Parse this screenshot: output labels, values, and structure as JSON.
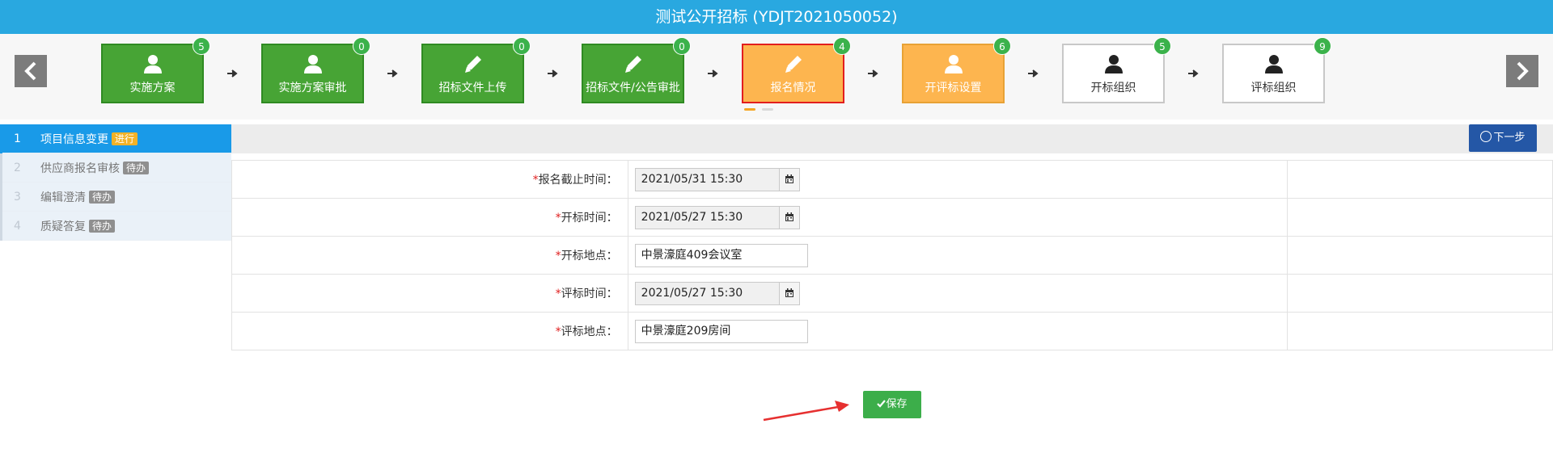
{
  "title": "测试公开招标 (YDJT2021050052)",
  "nav": {
    "prev_icon": "chevron-left-icon",
    "next_icon": "chevron-right-icon"
  },
  "steps": [
    {
      "label": "实施方案",
      "badge": "5",
      "icon": "user-icon",
      "state": "done"
    },
    {
      "label": "实施方案审批",
      "badge": "0",
      "icon": "user-icon",
      "state": "done"
    },
    {
      "label": "招标文件上传",
      "badge": "0",
      "icon": "pencil-icon",
      "state": "done"
    },
    {
      "label": "招标文件/公告审批",
      "badge": "0",
      "icon": "pencil-icon",
      "state": "done"
    },
    {
      "label": "报名情况",
      "badge": "4",
      "icon": "pencil-icon",
      "state": "current"
    },
    {
      "label": "开评标设置",
      "badge": "6",
      "icon": "user-icon",
      "state": "pending-active"
    },
    {
      "label": "开标组织",
      "badge": "5",
      "icon": "user-icon",
      "state": "pending"
    },
    {
      "label": "评标组织",
      "badge": "9",
      "icon": "user-icon",
      "state": "pending"
    }
  ],
  "sidebar": {
    "items": [
      {
        "num": "1",
        "label": "项目信息变更",
        "tag": "进行",
        "active": true
      },
      {
        "num": "2",
        "label": "供应商报名审核",
        "tag": "待办",
        "active": false
      },
      {
        "num": "3",
        "label": "编辑澄清",
        "tag": "待办",
        "active": false
      },
      {
        "num": "4",
        "label": "质疑答复",
        "tag": "待办",
        "active": false
      }
    ]
  },
  "toolbar": {
    "next_label": "下一步"
  },
  "form": {
    "rows": [
      {
        "required": "*",
        "label": "报名截止时间：",
        "value": "2021/05/31 15:30",
        "type": "date"
      },
      {
        "required": "*",
        "label": "开标时间：",
        "value": "2021/05/27 15:30",
        "type": "date"
      },
      {
        "required": "*",
        "label": "开标地点：",
        "value": "中景濠庭409会议室",
        "type": "text"
      },
      {
        "required": "*",
        "label": "评标时间：",
        "value": "2021/05/27 15:30",
        "type": "date"
      },
      {
        "required": "*",
        "label": "评标地点：",
        "value": "中景濠庭209房间",
        "type": "text"
      }
    ]
  },
  "actions": {
    "save_label": "保存"
  },
  "colors": {
    "header": "#29a8e0",
    "step_done": "#47a435",
    "step_current": "#fdb54f",
    "step_current_border": "#e21e1e",
    "sidebar_active": "#199ae8",
    "next_button": "#2457a6",
    "save_button": "#3cae4a",
    "annotation_arrow": "#e63030"
  }
}
